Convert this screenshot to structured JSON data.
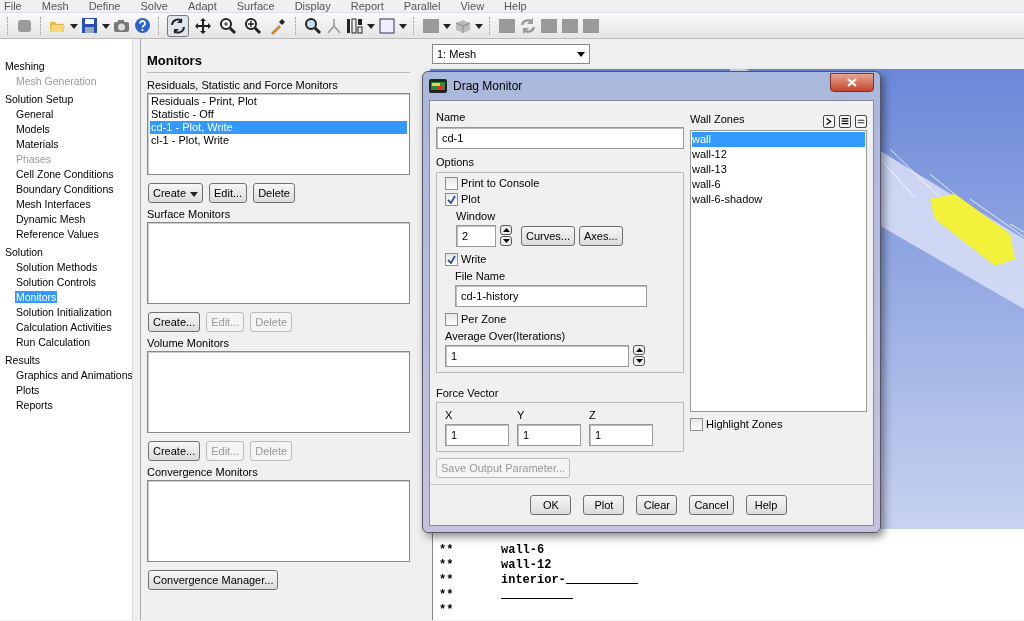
{
  "menu_bar": [
    "File",
    "Mesh",
    "Define",
    "Solve",
    "Adapt",
    "Surface",
    "Display",
    "Report",
    "Parallel",
    "View",
    "Help"
  ],
  "toolbar_tools": [
    {
      "selected": true
    },
    {
      "selected": false
    },
    {
      "selected": false
    },
    {
      "selected": false
    },
    {
      "selected": false
    }
  ],
  "navigation": [
    {
      "label": "Meshing",
      "children": [
        {
          "label": "Mesh Generation",
          "disabled": true,
          "selected": false
        }
      ]
    },
    {
      "label": "Solution Setup",
      "children": [
        {
          "label": "General",
          "disabled": false,
          "selected": false
        },
        {
          "label": "Models",
          "disabled": false,
          "selected": false
        },
        {
          "label": "Materials",
          "disabled": false,
          "selected": false
        },
        {
          "label": "Phases",
          "disabled": true,
          "selected": false
        },
        {
          "label": "Cell Zone Conditions",
          "disabled": false,
          "selected": false
        },
        {
          "label": "Boundary Conditions",
          "disabled": false,
          "selected": false
        },
        {
          "label": "Mesh Interfaces",
          "disabled": false,
          "selected": false
        },
        {
          "label": "Dynamic Mesh",
          "disabled": false,
          "selected": false
        },
        {
          "label": "Reference Values",
          "disabled": false,
          "selected": false
        }
      ]
    },
    {
      "label": "Solution",
      "children": [
        {
          "label": "Solution Methods",
          "disabled": false,
          "selected": false
        },
        {
          "label": "Solution Controls",
          "disabled": false,
          "selected": false
        },
        {
          "label": "Monitors",
          "disabled": false,
          "selected": true
        },
        {
          "label": "Solution Initialization",
          "disabled": false,
          "selected": false
        },
        {
          "label": "Calculation Activities",
          "disabled": false,
          "selected": false
        },
        {
          "label": "Run Calculation",
          "disabled": false,
          "selected": false
        }
      ]
    },
    {
      "label": "Results",
      "children": [
        {
          "label": "Graphics and Animations",
          "disabled": false,
          "selected": false
        },
        {
          "label": "Plots",
          "disabled": false,
          "selected": false
        },
        {
          "label": "Reports",
          "disabled": false,
          "selected": false
        }
      ]
    }
  ],
  "monitors_panel": {
    "title": "Monitors",
    "groups": [
      {
        "label": "Residuals, Statistic and Force Monitors",
        "items": [
          {
            "text": "Residuals - Print, Plot",
            "selected": false
          },
          {
            "text": "Statistic - Off",
            "selected": false
          },
          {
            "text": "cd-1 - Plot, Write",
            "selected": true
          },
          {
            "text": "cl-1 - Plot, Write",
            "selected": false
          }
        ],
        "buttons": [
          {
            "label": "Create",
            "dropdown": true,
            "disabled": false
          },
          {
            "label": "Edit...",
            "disabled": false
          },
          {
            "label": "Delete",
            "disabled": false
          }
        ]
      },
      {
        "label": "Surface Monitors",
        "buttons": [
          {
            "label": "Create...",
            "disabled": false
          },
          {
            "label": "Edit...",
            "disabled": true
          },
          {
            "label": "Delete",
            "disabled": true
          }
        ]
      },
      {
        "label": "Volume Monitors",
        "buttons": [
          {
            "label": "Create...",
            "disabled": false
          },
          {
            "label": "Edit...",
            "disabled": true
          },
          {
            "label": "Delete",
            "disabled": true
          }
        ]
      },
      {
        "label": "Convergence Monitors",
        "buttons": [
          {
            "label": "Convergence Manager...",
            "disabled": false
          }
        ]
      }
    ]
  },
  "graphics": {
    "window_select": "1: Mesh"
  },
  "console": [
    {
      "prefix": "**",
      "text": "wall-6"
    },
    {
      "prefix": "**",
      "text": "wall-12"
    },
    {
      "prefix": "**",
      "text": "interior-",
      "redacted": true
    },
    {
      "prefix": "**",
      "redacted": true
    },
    {
      "prefix": "**"
    }
  ],
  "dialog": {
    "title": "Drag Monitor",
    "name_label": "Name",
    "name_value": "cd-1",
    "options_label": "Options",
    "print_to_console": {
      "label": "Print to Console",
      "checked": false
    },
    "plot": {
      "label": "Plot",
      "checked": true
    },
    "window_label": "Window",
    "window_value": "2",
    "curves_button": "Curves...",
    "axes_button": "Axes...",
    "write": {
      "label": "Write",
      "checked": true
    },
    "file_name_label": "File Name",
    "file_name_value": "cd-1-history",
    "per_zone": {
      "label": "Per Zone",
      "checked": false
    },
    "average_label": "Average Over(Iterations)",
    "average_value": "1",
    "force_vector_label": "Force Vector",
    "force": [
      {
        "label": "X",
        "value": "1"
      },
      {
        "label": "Y",
        "value": "1"
      },
      {
        "label": "Z",
        "value": "1"
      }
    ],
    "save_button": {
      "label": "Save Output Parameter...",
      "disabled": true
    },
    "zones_label": "Wall Zones",
    "zones": [
      {
        "text": "wall",
        "selected": true
      },
      {
        "text": "wall-12",
        "selected": false
      },
      {
        "text": "wall-13",
        "selected": false
      },
      {
        "text": "wall-6",
        "selected": false
      },
      {
        "text": "wall-6-shadow",
        "selected": false
      }
    ],
    "highlight_zones": {
      "label": "Highlight Zones",
      "checked": false
    },
    "buttons": [
      "OK",
      "Plot",
      "Clear",
      "Cancel",
      "Help"
    ]
  }
}
